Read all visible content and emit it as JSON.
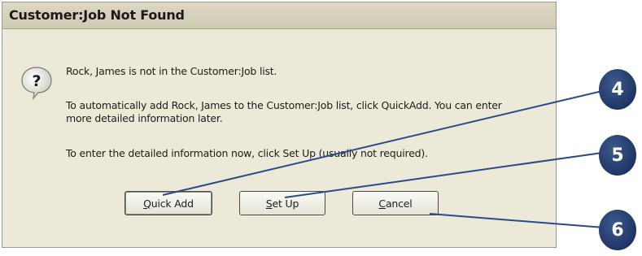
{
  "dialog": {
    "title": "Customer:Job Not Found",
    "messages": [
      "Rock, James is not in the Customer:Job list.",
      "To automatically add Rock, James to the Customer:Job list, click QuickAdd.  You can enter",
      "more detailed information later.",
      "To enter the detailed information now, click Set Up (usually not required)."
    ],
    "buttons": {
      "quick_add": {
        "first": "Q",
        "rest": "uick Add"
      },
      "set_up": {
        "first": "S",
        "rest": "et Up"
      },
      "cancel": {
        "first": "C",
        "rest": "ancel"
      }
    }
  },
  "callouts": [
    "4",
    "5",
    "6"
  ],
  "icons": {
    "dialog_icon": "question-icon"
  },
  "colors": {
    "callout": "#1c3060",
    "line": "#2a4a8a"
  }
}
